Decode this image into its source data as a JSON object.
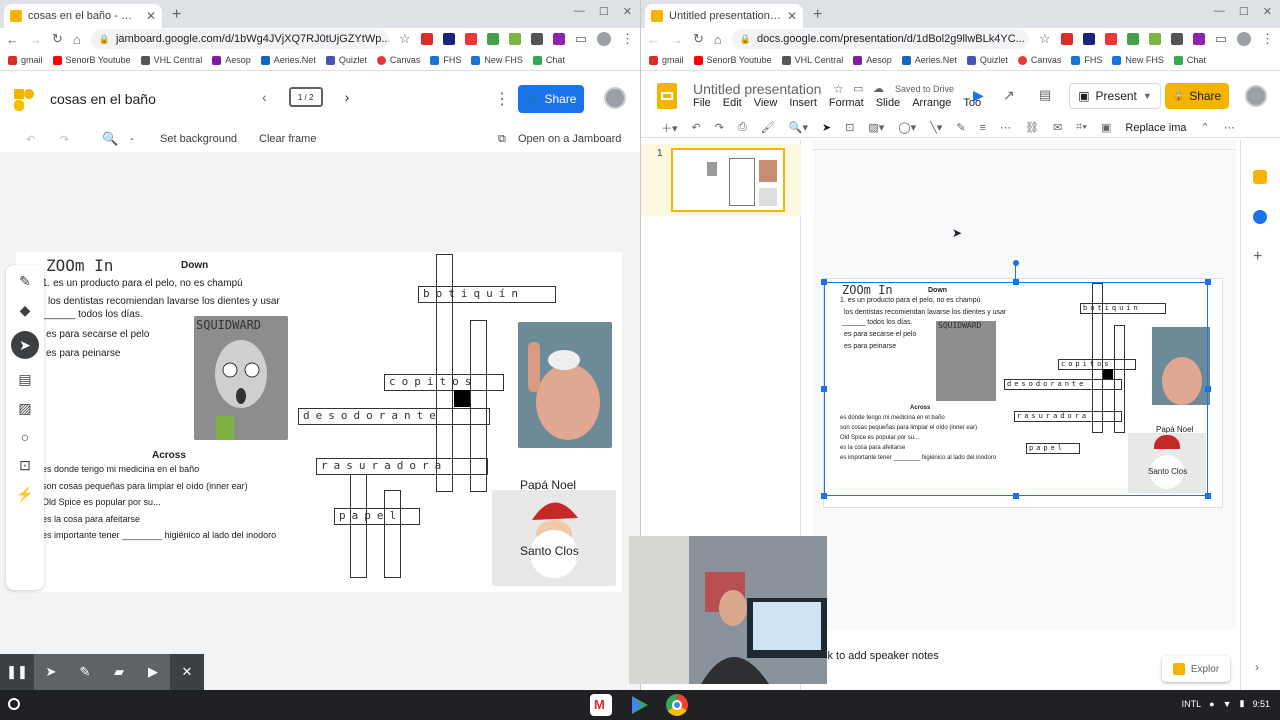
{
  "left": {
    "tab_title": "cosas en el baño - Google Jamb",
    "url": "jamboard.google.com/d/1bWg4JVjXQ7RJ0tUjGZYtWp...",
    "bookmarks": [
      "gmail",
      "SenorB Youtube",
      "VHL Central",
      "Aesop",
      "Aeries.Net",
      "Quizlet",
      "Canvas",
      "FHS",
      "New FHS",
      "Chat"
    ],
    "title": "cosas en el baño",
    "frame_counter": "1 / 2",
    "share": "Share",
    "tools": {
      "zoom_minus": "-",
      "set_background": "Set background",
      "clear_frame": "Clear frame",
      "open_on_jamboard": "Open on a Jamboard"
    },
    "sheet": {
      "zoom_note": "ZOOm In",
      "down_heading": "Down",
      "down_clues": [
        "1. es un producto para el pelo, no es champú",
        "los dentistas recomiendan lavarse los dientes y usar",
        "______ todos los días.",
        "es para secarse el pelo",
        "es para peinarse"
      ],
      "squidward": "SQUIDWARD",
      "across_heading": "Across",
      "across_clues": [
        "es donde tengo mi medicina en el baño",
        "son cosas pequeñas para limpiar el oído (inner ear)",
        "Old Spice es popular por su...",
        "es la cosa para afeitarse",
        "es importante tener ________ higiénico al lado del inodoro"
      ],
      "papa_noel": "Papá Noel",
      "santo_clos": "Santo Clos",
      "words": {
        "botiquin": "botiquín",
        "copitos": "copitos",
        "desodorante": "desodorante",
        "rasuradora": "rasuradora",
        "papel": "papel"
      }
    }
  },
  "right": {
    "tab_title": "Untitled presentation - Google S",
    "url": "docs.google.com/presentation/d/1dBol2g9llwBLk4YC...",
    "bookmarks": [
      "gmail",
      "SenorB Youtube",
      "VHL Central",
      "Aesop",
      "Aeries.Net",
      "Quizlet",
      "Canvas",
      "FHS",
      "New FHS",
      "Chat"
    ],
    "doc_title": "Untitled presentation",
    "saved": "Saved to Drive",
    "menus": [
      "File",
      "Edit",
      "View",
      "Insert",
      "Format",
      "Slide",
      "Arrange",
      "Too"
    ],
    "present": "Present",
    "share": "Share",
    "replace_image": "Replace ima",
    "slide_number": "1",
    "speaker_notes": "ck to add speaker notes",
    "explore": "Explor"
  },
  "shelf": {
    "lang": "INTL",
    "time": "9:51"
  },
  "colors": {
    "blue": "#1a73e8",
    "yellow": "#f4b400"
  }
}
